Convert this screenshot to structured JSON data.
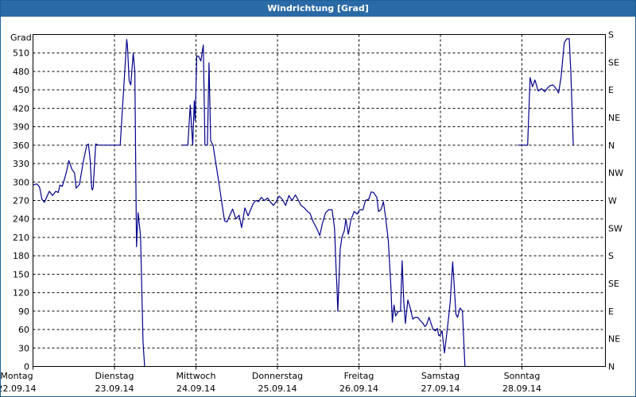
{
  "window": {
    "title": "Windrichtung [Grad]"
  },
  "chart_data": {
    "type": "line",
    "title": "Windrichtung [Grad]",
    "ylabel": "Grad",
    "ylim": [
      0,
      540
    ],
    "yticks": [
      0,
      30,
      60,
      90,
      120,
      150,
      180,
      210,
      240,
      270,
      300,
      330,
      360,
      390,
      420,
      450,
      480,
      510
    ],
    "right_ticks": [
      {
        "value": 0,
        "label": "N"
      },
      {
        "value": 45,
        "label": "NE"
      },
      {
        "value": 90,
        "label": "E"
      },
      {
        "value": 135,
        "label": "SE"
      },
      {
        "value": 180,
        "label": "S"
      },
      {
        "value": 225,
        "label": "SW"
      },
      {
        "value": 270,
        "label": "W"
      },
      {
        "value": 315,
        "label": "NW"
      },
      {
        "value": 360,
        "label": "N"
      },
      {
        "value": 405,
        "label": "NE"
      },
      {
        "value": 450,
        "label": "E"
      },
      {
        "value": 495,
        "label": "SE"
      },
      {
        "value": 540,
        "label": "S"
      }
    ],
    "xlim": [
      0,
      7
    ],
    "x_unit": "days since Montag 22.09.14 00:00",
    "days": [
      {
        "day": "Montag",
        "date": "22.09.14"
      },
      {
        "day": "Dienstag",
        "date": "23.09.14"
      },
      {
        "day": "Mittwoch",
        "date": "24.09.14"
      },
      {
        "day": "Donnerstag",
        "date": "25.09.14"
      },
      {
        "day": "Freitag",
        "date": "26.09.14"
      },
      {
        "day": "Samstag",
        "date": "27.09.14"
      },
      {
        "day": "Sonntag",
        "date": "28.09.14"
      }
    ],
    "grid": true,
    "line_color": "#00008b",
    "series": [
      {
        "name": "",
        "segments": [
          [
            [
              0.0,
              295
            ],
            [
              0.05,
              297
            ],
            [
              0.08,
              292
            ],
            [
              0.11,
              272
            ],
            [
              0.14,
              267
            ],
            [
              0.2,
              285
            ],
            [
              0.24,
              278
            ],
            [
              0.28,
              285
            ],
            [
              0.31,
              283
            ],
            [
              0.33,
              295
            ],
            [
              0.36,
              293
            ],
            [
              0.41,
              316
            ],
            [
              0.44,
              335
            ],
            [
              0.48,
              320
            ],
            [
              0.51,
              315
            ],
            [
              0.53,
              290
            ],
            [
              0.57,
              296
            ],
            [
              0.62,
              335
            ],
            [
              0.66,
              360
            ],
            [
              0.68,
              362
            ],
            [
              0.7,
              338
            ],
            [
              0.72,
              290
            ],
            [
              0.73,
              287
            ],
            [
              0.74,
              292
            ],
            [
              0.77,
              362
            ],
            [
              0.8,
              360
            ],
            [
              1.0,
              360
            ],
            [
              1.07,
              360
            ],
            [
              1.15,
              532
            ],
            [
              1.16,
              520
            ],
            [
              1.18,
              465
            ],
            [
              1.2,
              458
            ],
            [
              1.23,
              510
            ],
            [
              1.25,
              480
            ],
            [
              1.27,
              195
            ],
            [
              1.29,
              250
            ],
            [
              1.32,
              212
            ],
            [
              1.35,
              40
            ],
            [
              1.37,
              0
            ]
          ],
          [
            [
              1.82,
              360
            ],
            [
              1.9,
              360
            ],
            [
              1.93,
              425
            ],
            [
              1.96,
              360
            ],
            [
              1.98,
              432
            ],
            [
              1.99,
              400
            ],
            [
              2.01,
              505
            ],
            [
              2.03,
              505
            ],
            [
              2.06,
              497
            ],
            [
              2.09,
              523
            ],
            [
              2.11,
              360
            ],
            [
              2.14,
              360
            ],
            [
              2.16,
              494
            ],
            [
              2.18,
              367
            ],
            [
              2.21,
              360
            ],
            [
              2.28,
              300
            ],
            [
              2.35,
              237
            ],
            [
              2.38,
              235
            ],
            [
              2.42,
              247
            ],
            [
              2.45,
              256
            ],
            [
              2.49,
              240
            ],
            [
              2.53,
              246
            ],
            [
              2.56,
              226
            ],
            [
              2.6,
              258
            ],
            [
              2.64,
              245
            ],
            [
              2.67,
              255
            ],
            [
              2.71,
              267
            ],
            [
              2.74,
              270
            ],
            [
              2.77,
              268
            ],
            [
              2.8,
              275
            ],
            [
              2.84,
              270
            ],
            [
              2.88,
              274
            ],
            [
              2.91,
              268
            ],
            [
              2.95,
              262
            ],
            [
              2.98,
              267
            ],
            [
              3.02,
              277
            ],
            [
              3.06,
              272
            ],
            [
              3.1,
              262
            ],
            [
              3.14,
              278
            ],
            [
              3.18,
              270
            ],
            [
              3.22,
              279
            ],
            [
              3.25,
              272
            ],
            [
              3.29,
              262
            ],
            [
              3.33,
              258
            ],
            [
              3.37,
              252
            ],
            [
              3.4,
              249
            ],
            [
              3.44,
              235
            ],
            [
              3.48,
              225
            ],
            [
              3.52,
              213
            ],
            [
              3.55,
              232
            ],
            [
              3.59,
              250
            ],
            [
              3.63,
              255
            ],
            [
              3.67,
              255
            ],
            [
              3.7,
              225
            ],
            [
              3.72,
              157
            ],
            [
              3.73,
              130
            ],
            [
              3.74,
              90
            ],
            [
              3.77,
              190
            ],
            [
              3.79,
              210
            ],
            [
              3.82,
              221
            ],
            [
              3.84,
              240
            ],
            [
              3.87,
              215
            ],
            [
              3.9,
              238
            ],
            [
              3.94,
              252
            ],
            [
              3.98,
              248
            ],
            [
              4.01,
              255
            ],
            [
              4.05,
              255
            ],
            [
              4.08,
              270
            ],
            [
              4.12,
              272
            ],
            [
              4.15,
              284
            ],
            [
              4.18,
              283
            ],
            [
              4.22,
              275
            ],
            [
              4.24,
              252
            ],
            [
              4.27,
              255
            ],
            [
              4.3,
              268
            ],
            [
              4.33,
              240
            ],
            [
              4.36,
              205
            ],
            [
              4.39,
              135
            ],
            [
              4.41,
              72
            ],
            [
              4.43,
              100
            ],
            [
              4.45,
              82
            ],
            [
              4.48,
              89
            ],
            [
              4.51,
              90
            ],
            [
              4.53,
              172
            ],
            [
              4.55,
              105
            ],
            [
              4.57,
              70
            ],
            [
              4.6,
              108
            ],
            [
              4.63,
              95
            ],
            [
              4.66,
              77
            ],
            [
              4.69,
              80
            ],
            [
              4.72,
              80
            ],
            [
              4.75,
              75
            ],
            [
              4.78,
              71
            ],
            [
              4.81,
              65
            ],
            [
              4.83,
              68
            ],
            [
              4.86,
              80
            ],
            [
              4.88,
              72
            ],
            [
              4.91,
              60
            ],
            [
              4.94,
              58
            ],
            [
              4.96,
              62
            ],
            [
              4.98,
              50
            ],
            [
              5.0,
              52
            ],
            [
              5.02,
              58
            ],
            [
              5.05,
              22
            ],
            [
              5.07,
              45
            ],
            [
              5.1,
              80
            ],
            [
              5.12,
              105
            ],
            [
              5.15,
              170
            ],
            [
              5.17,
              130
            ],
            [
              5.19,
              85
            ],
            [
              5.21,
              80
            ],
            [
              5.24,
              95
            ],
            [
              5.27,
              90
            ],
            [
              5.3,
              0
            ]
          ],
          [
            [
              5.95,
              360
            ],
            [
              6.07,
              360
            ],
            [
              6.1,
              470
            ],
            [
              6.13,
              455
            ],
            [
              6.16,
              466
            ],
            [
              6.2,
              448
            ],
            [
              6.24,
              452
            ],
            [
              6.28,
              447
            ],
            [
              6.32,
              454
            ],
            [
              6.35,
              457
            ],
            [
              6.38,
              458
            ],
            [
              6.42,
              452
            ],
            [
              6.45,
              445
            ],
            [
              6.48,
              470
            ],
            [
              6.52,
              527
            ],
            [
              6.55,
              533
            ],
            [
              6.58,
              533
            ],
            [
              6.6,
              480
            ],
            [
              6.63,
              360
            ]
          ]
        ]
      }
    ]
  }
}
